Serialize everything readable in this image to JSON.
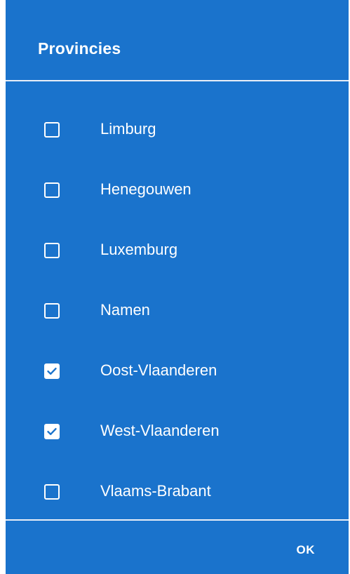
{
  "dialog": {
    "title": "Provincies",
    "items": [
      {
        "label": "Limburg",
        "checked": false
      },
      {
        "label": "Henegouwen",
        "checked": false
      },
      {
        "label": "Luxemburg",
        "checked": false
      },
      {
        "label": "Namen",
        "checked": false
      },
      {
        "label": "Oost-Vlaanderen",
        "checked": true
      },
      {
        "label": "West-Vlaanderen",
        "checked": true
      },
      {
        "label": "Vlaams-Brabant",
        "checked": false
      }
    ],
    "ok_label": "OK"
  },
  "colors": {
    "background": "#1a73cc",
    "foreground": "#ffffff",
    "divider": "#e8eef7"
  },
  "icons": {
    "checked": "checkbox-checked-icon",
    "unchecked": "checkbox-unchecked-icon"
  }
}
